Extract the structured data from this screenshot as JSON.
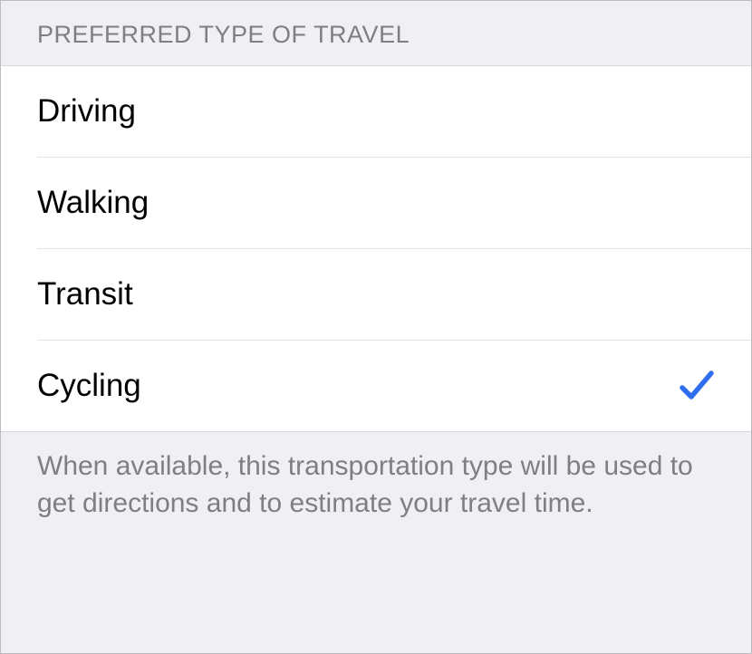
{
  "section": {
    "header": "PREFERRED TYPE OF TRAVEL",
    "footer": "When available, this transportation type will be used to get directions and to estimate your travel time.",
    "items": [
      {
        "label": "Driving",
        "selected": false
      },
      {
        "label": "Walking",
        "selected": false
      },
      {
        "label": "Transit",
        "selected": false
      },
      {
        "label": "Cycling",
        "selected": true
      }
    ]
  },
  "colors": {
    "accent": "#2f6fef"
  }
}
